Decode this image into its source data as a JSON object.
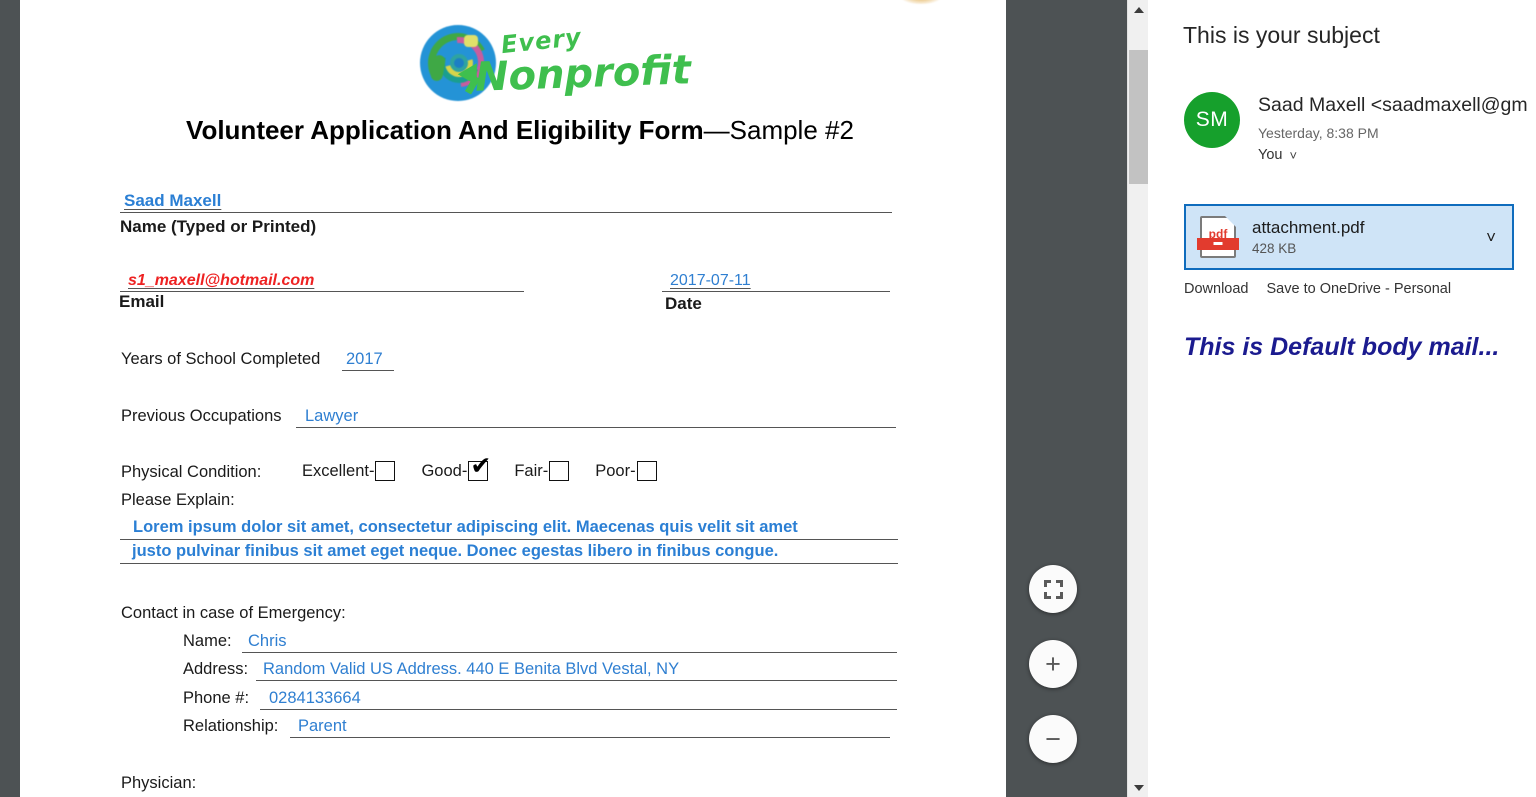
{
  "viewer": {
    "zoom_controls": [
      {
        "name": "fit-to-page",
        "label": ""
      },
      {
        "name": "zoom-in",
        "label": "+"
      },
      {
        "name": "zoom-out",
        "label": "−"
      }
    ],
    "scrollbar": {
      "up": "▲",
      "down": "▼"
    }
  },
  "document": {
    "logo": {
      "line1": "Every",
      "line2": "Nonprofit"
    },
    "title_bold": "Volunteer Application And Eligibility Form",
    "title_regular": "—Sample #2",
    "name": {
      "value": "Saad Maxell",
      "label": "Name (Typed or Printed)"
    },
    "email": {
      "value": "s1_maxell@hotmail.com",
      "label": "Email"
    },
    "date": {
      "value": "2017-07-11",
      "label": "Date"
    },
    "years_of_school": {
      "label": "Years of School Completed",
      "value": "2017"
    },
    "previous_occupations": {
      "label": "Previous Occupations",
      "value": "Lawyer"
    },
    "physical_condition": {
      "label": "Physical Condition:",
      "options": [
        {
          "label": "Excellent-",
          "checked": false
        },
        {
          "label": "Good-",
          "checked": true
        },
        {
          "label": "Fair-",
          "checked": false
        },
        {
          "label": "Poor-",
          "checked": false
        }
      ],
      "checkmark": "✔"
    },
    "please_explain": {
      "label": "Please Explain:",
      "line1": "Lorem ipsum dolor sit amet, consectetur adipiscing elit. Maecenas quis velit sit amet",
      "line2": "justo pulvinar finibus sit amet eget neque. Donec egestas libero in finibus congue."
    },
    "emergency": {
      "heading": "Contact in case of Emergency:",
      "name_label": "Name:",
      "name_value": "Chris",
      "address_label": "Address:",
      "address_value": "Random Valid US Address. 440 E Benita Blvd Vestal, NY",
      "phone_label": "Phone #:",
      "phone_value": "0284133664",
      "relationship_label": "Relationship:",
      "relationship_value": "Parent"
    },
    "physician_label": "Physician:"
  },
  "mail": {
    "subject": "This is your subject",
    "avatar_initials": "SM",
    "sender": "Saad Maxell <saadmaxell@gm",
    "sent_time": "Yesterday, 8:38 PM",
    "recipients": "You",
    "recipients_caret": "˅",
    "attachment": {
      "icon_text": "pdf",
      "filename": "attachment.pdf",
      "size": "428 KB",
      "caret": "˅",
      "download_label": "Download",
      "onedrive_label": "Save to OneDrive - Personal"
    },
    "body": "This is Default body mail..."
  },
  "colors": {
    "viewer_bg": "#4d5254",
    "accent_blue": "#0f6cbd",
    "attachment_bg": "#cfe4f7",
    "avatar_green": "#16a02c",
    "field_blue": "#2f7fd1",
    "email_red": "#ee2222",
    "body_navy": "#1b1b8f",
    "logo_green": "#3fbf4e",
    "logo_circle_blue": "#2493d6",
    "pdf_icon_red": "#e23b2e"
  }
}
